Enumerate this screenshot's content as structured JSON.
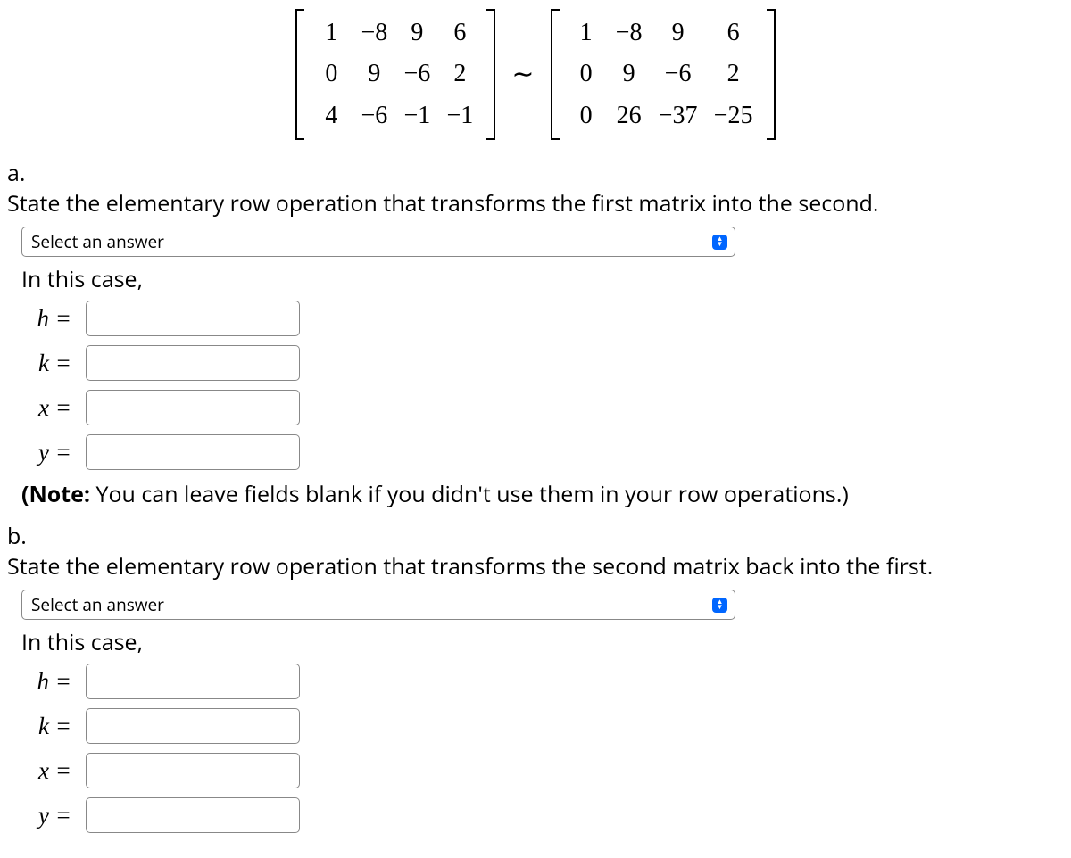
{
  "matrix1": [
    [
      "1",
      "−8",
      "9",
      "6"
    ],
    [
      "0",
      "9",
      "−6",
      "2"
    ],
    [
      "4",
      "−6",
      "−1",
      "−1"
    ]
  ],
  "matrix2": [
    [
      "1",
      "−8",
      "9",
      "6"
    ],
    [
      "0",
      "9",
      "−6",
      "2"
    ],
    [
      "0",
      "26",
      "−37",
      "−25"
    ]
  ],
  "tilde": "∼",
  "part_a": {
    "label": "a.",
    "question": "State the elementary row operation that transforms the first matrix into the second.",
    "select_placeholder": "Select an answer",
    "subtext": "In this case,",
    "vars": {
      "h": {
        "label": "h",
        "value": ""
      },
      "k": {
        "label": "k",
        "value": ""
      },
      "x": {
        "label": "x",
        "value": ""
      },
      "y": {
        "label": "y",
        "value": ""
      }
    },
    "note_bold": "(Note:",
    "note_rest": " You can leave fields blank if you didn't use them in your row operations.)"
  },
  "part_b": {
    "label": "b.",
    "question": "State the elementary row operation that transforms the second matrix back into the first.",
    "select_placeholder": "Select an answer",
    "subtext": "In this case,",
    "vars": {
      "h": {
        "label": "h",
        "value": ""
      },
      "k": {
        "label": "k",
        "value": ""
      },
      "x": {
        "label": "x",
        "value": ""
      },
      "y": {
        "label": "y",
        "value": ""
      }
    }
  },
  "equals": "="
}
